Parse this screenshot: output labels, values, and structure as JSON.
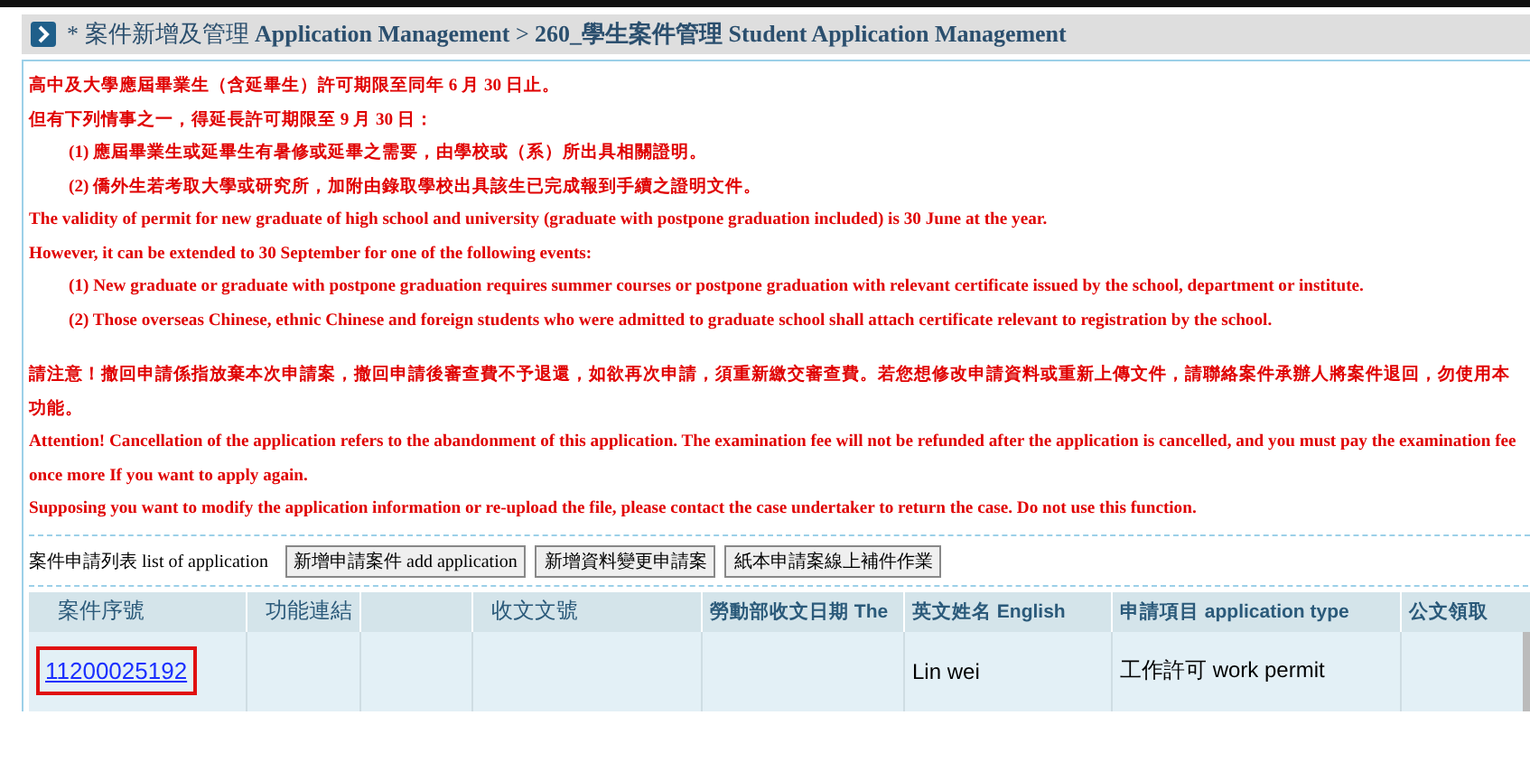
{
  "breadcrumb": {
    "prefix": "* 案件新增及管理",
    "part1": "Application Management",
    "separator": ">",
    "part2": "260_學生案件管理",
    "part3": "Student Application Management"
  },
  "notices": [
    {
      "kind": "plain",
      "text": "高中及大學應屆畢業生（含延畢生）許可期限至同年 6 月 30 日止。"
    },
    {
      "kind": "plain",
      "text": "但有下列情事之一，得延長許可期限至 9 月 30 日："
    },
    {
      "kind": "indent",
      "text": "(1) 應屆畢業生或延畢生有暑修或延畢之需要，由學校或（系）所出具相關證明。"
    },
    {
      "kind": "indent",
      "text": "(2) 僑外生若考取大學或研究所，加附由錄取學校出具該生已完成報到手續之證明文件。"
    },
    {
      "kind": "plain",
      "text": "The validity of permit for new graduate of high school and university (graduate with postpone graduation included) is 30 June at the year."
    },
    {
      "kind": "plain",
      "text": "However, it can be extended to 30 September for one of the following events:"
    },
    {
      "kind": "indent",
      "text": "(1) New graduate or graduate with postpone graduation requires summer courses or postpone graduation with relevant certificate issued by the school, department or institute."
    },
    {
      "kind": "indent",
      "text": "(2) Those overseas Chinese, ethnic Chinese and foreign students who were admitted to graduate school shall attach certificate relevant to registration by the school."
    }
  ],
  "attention": [
    "請注意！撤回申請係指放棄本次申請案，撤回申請後審查費不予退還，如欲再次申請，須重新繳交審查費。若您想修改申請資料或重新上傳文件，請聯絡案件承辦人將案件退回，勿使用本功能。",
    "Attention! Cancellation of the application refers to the abandonment of this application. The examination fee will not be refunded after the application is cancelled, and you must pay the examination fee once more If you want to apply again.",
    "Supposing you want to modify the application information or re-upload the file, please contact the case undertaker to return the case. Do not use this function."
  ],
  "toolbar": {
    "label": "案件申請列表 list of application",
    "buttons": [
      "新增申請案件 add application",
      "新增資料變更申請案",
      "紙本申請案線上補件作業"
    ]
  },
  "table": {
    "columns": [
      "案件序號",
      "功能連結",
      "",
      "收文文號",
      "勞動部收文日期 The",
      "英文姓名 English",
      "申請項目 application type",
      "公文領取"
    ],
    "rows": [
      {
        "cells": [
          "11200025192",
          "",
          "",
          "",
          "",
          "Lin wei",
          "工作許可 work permit",
          ""
        ],
        "highlighted": true
      }
    ]
  }
}
